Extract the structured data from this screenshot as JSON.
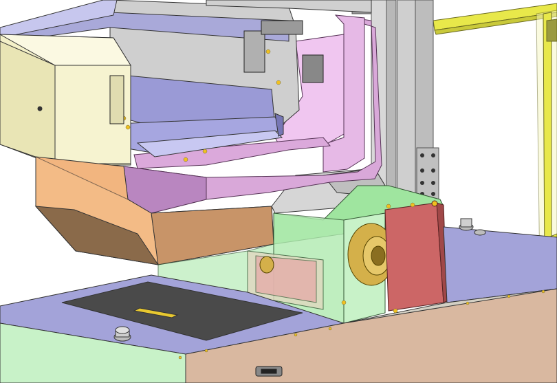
{
  "scene": {
    "description_visible_text": [],
    "colors": {
      "background": "#ffffff",
      "cream_housing": "#f3f0c8",
      "cream_shadow": "#dedaa8",
      "steel_gray": "#c8c8c8",
      "lavender_plate": "#a3a3d9",
      "pink_bracket": "#d9a8d9",
      "pink_bracket_dark": "#b986c0",
      "orange_box": "#f2b57f",
      "brown_box": "#8a6a4a",
      "green_frame": "#9fe59f",
      "green_light": "#c8f2c8",
      "red_panel": "#cc6666",
      "gold_gear": "#d4b04a",
      "yellow_truss": "#e8e84a",
      "tan_base": "#d9b8a0",
      "dark_slate": "#4a4a4a",
      "bolt": "#f0c020"
    }
  }
}
